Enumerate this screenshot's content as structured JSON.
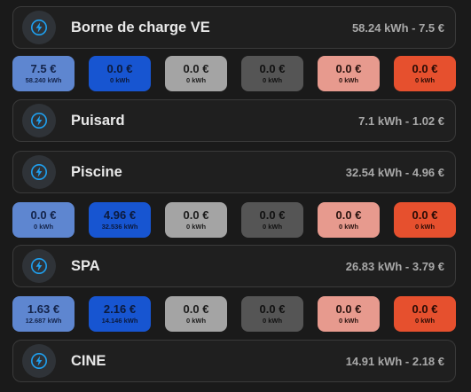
{
  "colors": {
    "chip_light_blue": "#5e86d0",
    "chip_dark_blue": "#1755d1",
    "chip_light_gray": "#a4a4a4",
    "chip_dark_gray": "#555555",
    "chip_salmon": "#e79a8e",
    "chip_orange": "#e6502e",
    "icon_accent": "#1fa0f0"
  },
  "cards": [
    {
      "name": "Borne de charge VE",
      "summary": "58.24 kWh - 7.5 €",
      "icon": "lightning-bolt-icon"
    },
    {
      "name": "Puisard",
      "summary": "7.1 kWh - 1.02 €",
      "icon": "lightning-bolt-icon"
    },
    {
      "name": "Piscine",
      "summary": "32.54 kWh - 4.96 €",
      "icon": "lightning-bolt-icon"
    },
    {
      "name": "SPA",
      "summary": "26.83 kWh - 3.79 €",
      "icon": "lightning-bolt-icon"
    },
    {
      "name": "CINE",
      "summary": "14.91 kWh - 2.18 €",
      "icon": "lightning-bolt-icon"
    }
  ],
  "chip_rows": [
    [
      {
        "amount": "7.5 €",
        "kwh": "58.240 kWh"
      },
      {
        "amount": "0.0 €",
        "kwh": "0 kWh"
      },
      {
        "amount": "0.0 €",
        "kwh": "0 kWh"
      },
      {
        "amount": "0.0 €",
        "kwh": "0 kWh"
      },
      {
        "amount": "0.0 €",
        "kwh": "0 kWh"
      },
      {
        "amount": "0.0 €",
        "kwh": "0 kWh"
      }
    ],
    [
      {
        "amount": "0.0 €",
        "kwh": "0 kWh"
      },
      {
        "amount": "4.96 €",
        "kwh": "32.536 kWh"
      },
      {
        "amount": "0.0 €",
        "kwh": "0 kWh"
      },
      {
        "amount": "0.0 €",
        "kwh": "0 kWh"
      },
      {
        "amount": "0.0 €",
        "kwh": "0 kWh"
      },
      {
        "amount": "0.0 €",
        "kwh": "0 kWh"
      }
    ],
    [
      {
        "amount": "1.63 €",
        "kwh": "12.687 kWh"
      },
      {
        "amount": "2.16 €",
        "kwh": "14.146 kWh"
      },
      {
        "amount": "0.0 €",
        "kwh": "0 kWh"
      },
      {
        "amount": "0.0 €",
        "kwh": "0 kWh"
      },
      {
        "amount": "0.0 €",
        "kwh": "0 kWh"
      },
      {
        "amount": "0.0 €",
        "kwh": "0 kWh"
      }
    ]
  ]
}
